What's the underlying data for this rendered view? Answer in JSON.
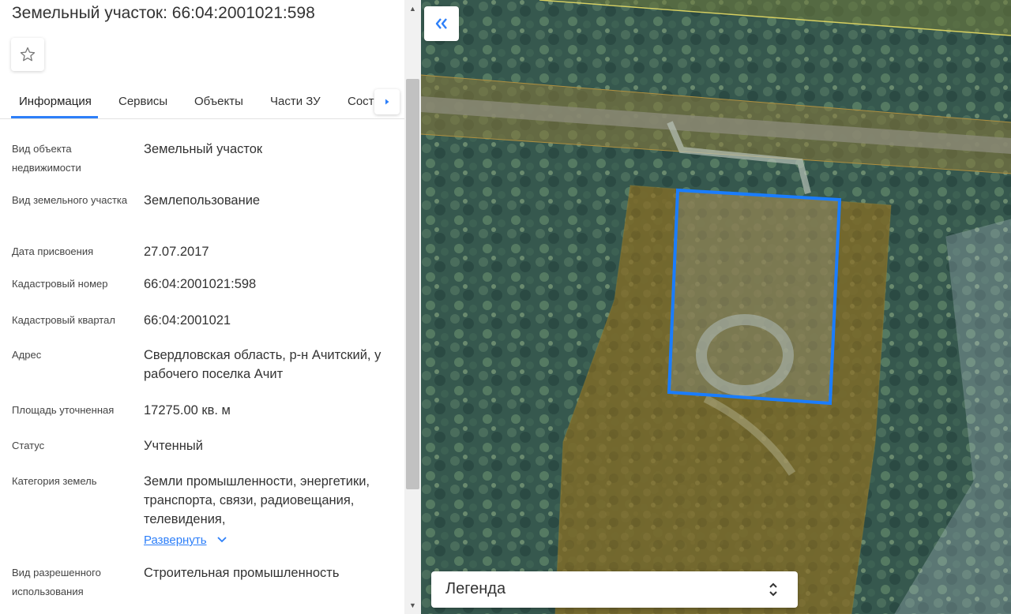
{
  "header": {
    "title": "Земельный участок: 66:04:2001021:598"
  },
  "icons": {
    "favorite": "star-outline-icon",
    "tabs_next": "caret-right-icon",
    "collapse": "double-chevron-left-icon",
    "expand": "chevron-down-icon",
    "legend_toggle": "up-down-arrows-icon"
  },
  "tabs": [
    {
      "label": "Информация",
      "active": true
    },
    {
      "label": "Сервисы"
    },
    {
      "label": "Объекты"
    },
    {
      "label": "Части ЗУ"
    },
    {
      "label": "Сост"
    }
  ],
  "info": {
    "type_label": "Вид объекта недвижимости",
    "type_value": "Земельный участок",
    "land_type_label": "Вид земельного участка",
    "land_type_value": "Землепользование",
    "date_label": "Дата присвоения",
    "date_value": "27.07.2017",
    "cad_num_label": "Кадастровый номер",
    "cad_num_value": "66:04:2001021:598",
    "cad_block_label": "Кадастровый квартал",
    "cad_block_value": "66:04:2001021",
    "address_label": "Адрес",
    "address_value": "Свердловская область, р-н Ачитский, у рабочего поселка Ачит",
    "area_label": "Площадь уточненная",
    "area_value": "17275.00 кв. м",
    "status_label": "Статус",
    "status_value": "Учтенный",
    "category_label": "Категория земель",
    "category_value": "Земли промышленности, энергетики, транспорта, связи, радиовещания, телевидения,",
    "expand_label": "Развернуть",
    "use_label": "Вид разрешенного использования",
    "use_value": "Строительная промышленность"
  },
  "map": {
    "legend_label": "Легенда",
    "colors": {
      "parcel_outline": "#1a7dff",
      "zone_fill": "#8a6a1a",
      "accent": "#2d7ff9"
    }
  }
}
